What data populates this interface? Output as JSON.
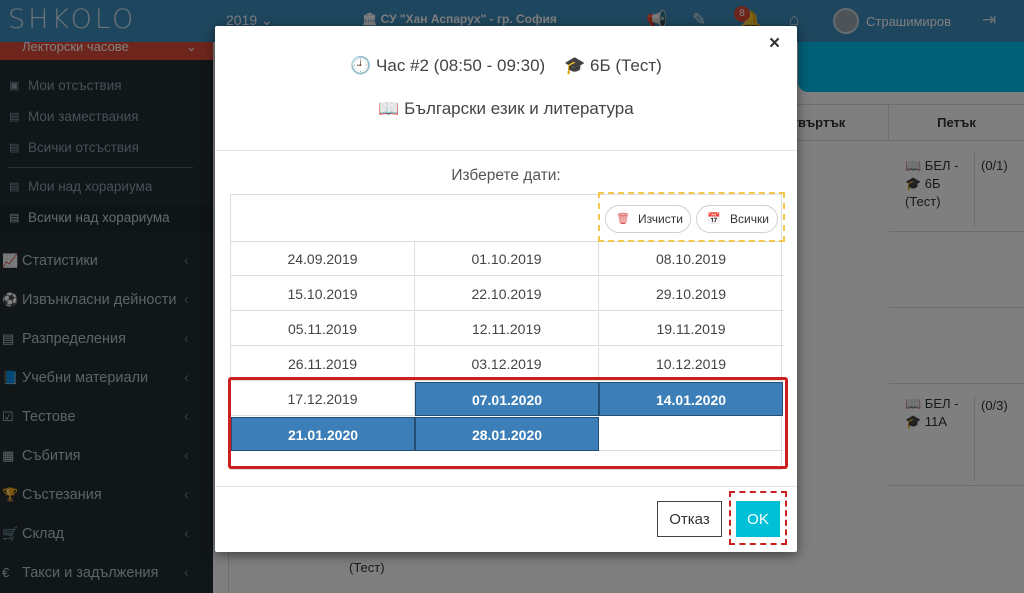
{
  "topbar": {
    "logo": "SHKOLO",
    "year": "2019 ⌄",
    "school": "🏛 СУ \"Хан Аспарух\" - гр. София",
    "notifications_count": "8",
    "user_name": "Страшимиров"
  },
  "sidebar": {
    "active_section": "Лекторски часове",
    "sub_items": [
      "Мои отсъствия",
      "Мои замествания",
      "Всички отсъствия",
      "Мои над хорариума",
      "Всички над хорариума"
    ],
    "items": [
      "Статистики",
      "Извънкласни дейности",
      "Разпределения",
      "Учебни материали",
      "Тестове",
      "Събития",
      "Състезания",
      "Склад",
      "Такси и задължения"
    ]
  },
  "schedule": {
    "headers": [
      "",
      "",
      "",
      "",
      "твъртък",
      "Петък"
    ],
    "cell_bel_6b": [
      "📖 БЕЛ -",
      "🎓 6Б",
      "(Тест)"
    ],
    "cell_count_1": "(0/1)",
    "cell_bel_11a": [
      "📖 БЕЛ -",
      "🎓 11А"
    ],
    "cell_count_3": "(0/3)",
    "cell_test": "(Тест)"
  },
  "modal": {
    "close": "×",
    "hour": "🕘 Час #2 (08:50 - 09:30)",
    "class": "🎓 6Б (Тест)",
    "subject": "📖 Български език и литература",
    "choose_label": "Изберете дати:",
    "clear_button": "Изчисти",
    "all_button": "Всички",
    "dates": [
      [
        "24.09.2019",
        "01.10.2019",
        "08.10.2019"
      ],
      [
        "15.10.2019",
        "22.10.2019",
        "29.10.2019"
      ],
      [
        "05.11.2019",
        "12.11.2019",
        "19.11.2019"
      ],
      [
        "26.11.2019",
        "03.12.2019",
        "10.12.2019"
      ],
      [
        "17.12.2019",
        "07.01.2020",
        "14.01.2020"
      ],
      [
        "21.01.2020",
        "28.01.2020",
        ""
      ]
    ],
    "selected": [
      "07.01.2020",
      "14.01.2020",
      "21.01.2020",
      "28.01.2020"
    ],
    "cancel_button": "Отказ",
    "ok_button": "OK"
  }
}
